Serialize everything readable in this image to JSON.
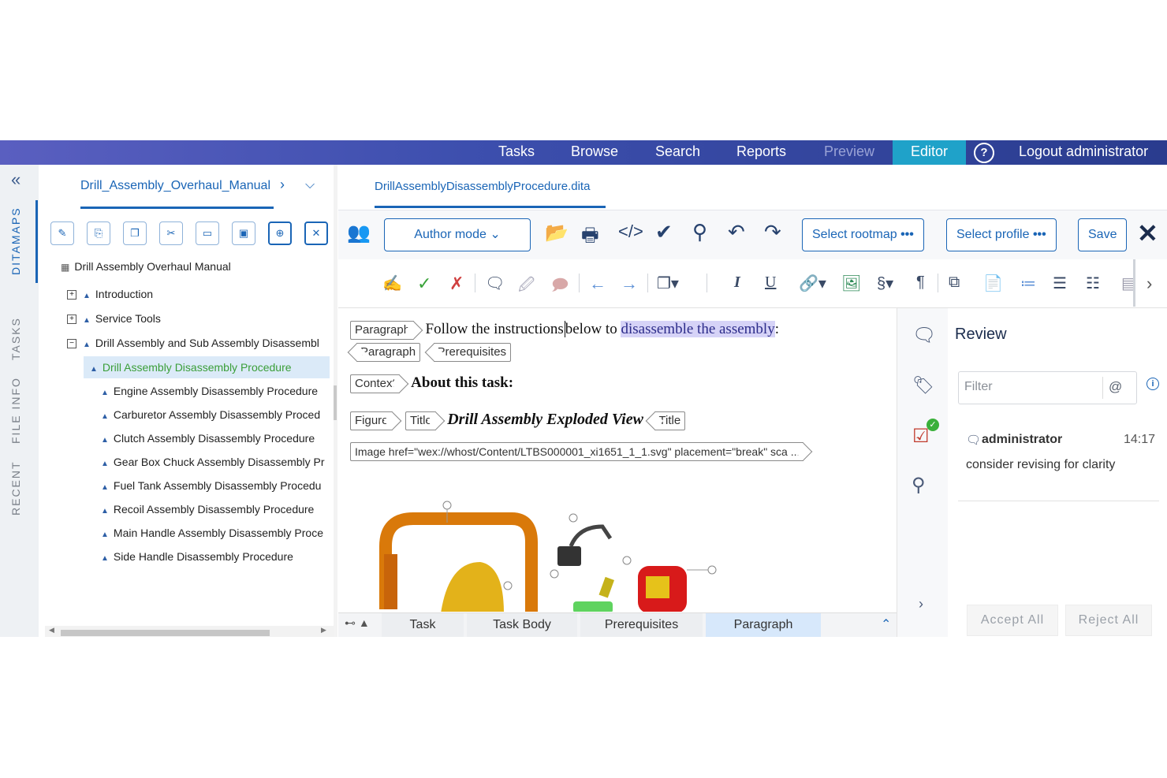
{
  "nav": {
    "items": [
      {
        "label": "Tasks",
        "state": "normal"
      },
      {
        "label": "Browse",
        "state": "normal"
      },
      {
        "label": "Search",
        "state": "normal"
      },
      {
        "label": "Reports",
        "state": "normal"
      },
      {
        "label": "Preview",
        "state": "disabled"
      },
      {
        "label": "Editor",
        "state": "active"
      }
    ],
    "help_icon": "question-circle-icon",
    "logout_label": "Logout administrator",
    "active_color": "#1fa2c9"
  },
  "rail": {
    "collapse_icon": "double-chevron-left-icon",
    "tabs": [
      "DITAMAPS",
      "TASKS",
      "FILE INFO",
      "RECENT"
    ],
    "active_tab": "DITAMAPS"
  },
  "map_panel": {
    "breadcrumb": "Drill_Assembly_Overhaul_Manual",
    "tools": [
      "edit-icon",
      "new-topic-icon",
      "copy-icon",
      "cut-icon",
      "paste-icon",
      "save-icon",
      "unlock-icon",
      "close-icon"
    ],
    "root": "Drill Assembly Overhaul Manual",
    "nodes": [
      {
        "label": "Introduction",
        "expander": "⊞"
      },
      {
        "label": "Service Tools",
        "expander": "⊞"
      },
      {
        "label": "Drill Assembly and Sub Assembly Disassembl",
        "expander": "⊟"
      }
    ],
    "children": [
      {
        "label": "Drill Assembly Disassembly Procedure",
        "selected": true
      },
      {
        "label": "Engine Assembly Disassembly Procedure"
      },
      {
        "label": "Carburetor Assembly Disassembly Proced"
      },
      {
        "label": "Clutch Assembly Disassembly Procedure"
      },
      {
        "label": "Gear Box Chuck Assembly Disassembly Pr"
      },
      {
        "label": "Fuel Tank Assembly Disassembly Procedu"
      },
      {
        "label": "Recoil Assembly Disassembly Procedure"
      },
      {
        "label": "Main Handle Assembly Disassembly Proce"
      },
      {
        "label": "Side Handle Disassembly Procedure"
      }
    ]
  },
  "editor": {
    "doc_tab": "DrillAssemblyDisassemblyProcedure.dita",
    "mode_label": "Author mode",
    "rootmap_label": "Select rootmap",
    "profile_label": "Select profile",
    "save_label": "Save",
    "content": {
      "p1_tag": "Paragraph",
      "p1_text_a": "Follow the instructions",
      "p1_text_b": "below to ",
      "p1_highlight": "disassemble the assembly",
      "p1_end": ":",
      "p1_close_tag": "Paragraph",
      "prereq_close_tag": "Prerequisites",
      "context_tag": "Context",
      "context_text": "About this task:",
      "figure_tag": "Figure",
      "title_tag": "Title",
      "title_text": "Drill Assembly Exploded View",
      "title_close_tag": "Title",
      "image_tag": "Image href=\"wex://whost/Content/LTBS000001_xi1651_1_1.svg\" placement=\"break\" sca ..."
    },
    "path": [
      "Task",
      "Task Body",
      "Prerequisites",
      "Paragraph"
    ],
    "active_path": "Paragraph"
  },
  "review": {
    "title": "Review",
    "filter_placeholder": "Filter",
    "at_icon": "@",
    "comment": {
      "author": "administrator",
      "time": "14:17",
      "text": "consider revising for clarity"
    },
    "accept_all": "Accept All",
    "reject_all": "Reject All"
  }
}
